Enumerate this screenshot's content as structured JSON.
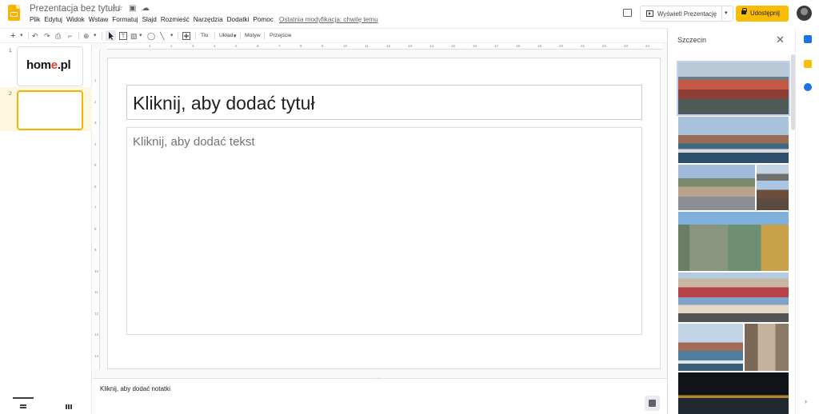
{
  "header": {
    "doc_title": "Prezentacja bez tytułu",
    "star_icon": "☆",
    "folder_icon": "▣",
    "cloud_icon": "☁",
    "menu": [
      "Plik",
      "Edytuj",
      "Widok",
      "Wstaw",
      "Formatuj",
      "Slajd",
      "Rozmieść",
      "Narzędzia",
      "Dodatki",
      "Pomoc"
    ],
    "last_edit": "Ostatnia modyfikacja: chwilę temu",
    "present_label": "Wyświetl Prezentację",
    "present_dropdown": "▾",
    "share_label": "Udostępnij"
  },
  "toolbar": {
    "new_slide": "+",
    "new_slide_dd": "▾",
    "undo": "↶",
    "redo": "↷",
    "print": "⎙",
    "paint_format": "⌐",
    "zoom": "⊕",
    "zoom_dd": "▾",
    "textbox": "T",
    "image": "▧",
    "image_dd": "▾",
    "shape": "◯",
    "line": "╲",
    "line_dd": "▾",
    "comment": "✚",
    "background": "Tło",
    "layout": "Układ",
    "layout_dd": "▾",
    "theme": "Motyw",
    "transition": "Przejście"
  },
  "ruler": {
    "top_ticks": [
      "1",
      "2",
      "3",
      "4",
      "5",
      "6",
      "7",
      "8",
      "9",
      "10",
      "11",
      "12",
      "13",
      "14",
      "15",
      "16",
      "17",
      "18",
      "19",
      "20",
      "21",
      "22",
      "23",
      "24",
      "25"
    ],
    "left_ticks": [
      "1",
      "2",
      "3",
      "4",
      "5",
      "6",
      "7",
      "8",
      "9",
      "10",
      "11",
      "12",
      "13",
      "14"
    ]
  },
  "filmstrip": {
    "slides": [
      {
        "number": "1",
        "logo_main": "hom",
        "logo_accent": "e",
        "logo_tail": ".pl"
      },
      {
        "number": "2"
      }
    ]
  },
  "slide": {
    "title_placeholder": "Kliknij, aby dodać tytuł",
    "body_placeholder": "Kliknij, aby dodać tekst"
  },
  "notes": {
    "placeholder": "Kliknij, aby dodać notatki",
    "handle": "· · ·"
  },
  "side_panel": {
    "title": "Szczecin",
    "close_icon": "✕",
    "expand_icon": "›"
  },
  "colors": {
    "accent": "#fbbc04",
    "slides_brand": "#f4b400",
    "selected_slide_bg": "#fef7e0",
    "link_blue": "#1a73e8"
  }
}
